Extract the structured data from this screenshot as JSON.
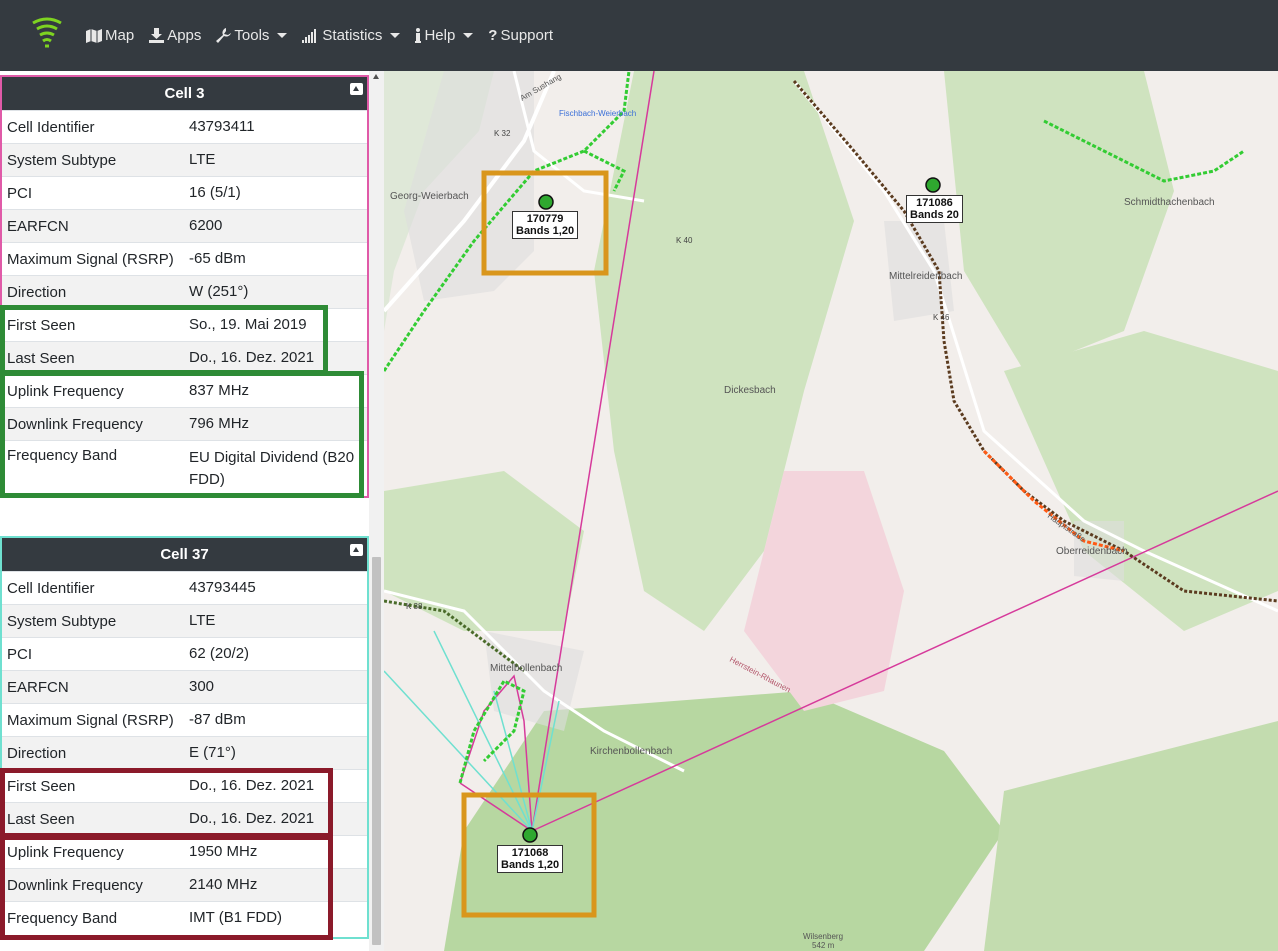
{
  "nav": {
    "items": [
      {
        "label": "Map",
        "icon": "map-icon",
        "dropdown": false
      },
      {
        "label": "Apps",
        "icon": "download-icon",
        "dropdown": false
      },
      {
        "label": "Tools",
        "icon": "wrench-icon",
        "dropdown": true
      },
      {
        "label": "Statistics",
        "icon": "signal-icon",
        "dropdown": true
      },
      {
        "label": "Help",
        "icon": "info-icon",
        "dropdown": true
      },
      {
        "label": "Support",
        "icon": "question-icon",
        "dropdown": false
      }
    ]
  },
  "cells": [
    {
      "title": "Cell 3",
      "rows": [
        {
          "label": "Cell Identifier",
          "value": "43793411"
        },
        {
          "label": "System Subtype",
          "value": "LTE"
        },
        {
          "label": "PCI",
          "value": "16 (5/1)"
        },
        {
          "label": "EARFCN",
          "value": "6200"
        },
        {
          "label": "Maximum Signal (RSRP)",
          "value": "-65 dBm"
        },
        {
          "label": "Direction",
          "value": "W (251°)"
        },
        {
          "label": "First Seen",
          "value": "So., 19. Mai 2019"
        },
        {
          "label": "Last Seen",
          "value": "Do., 16. Dez. 2021"
        },
        {
          "label": "Uplink Frequency",
          "value": "837 MHz"
        },
        {
          "label": "Downlink Frequency",
          "value": "796 MHz"
        },
        {
          "label": "Frequency Band",
          "value": "EU Digital Dividend (B20 FDD)"
        }
      ]
    },
    {
      "title": "Cell 37",
      "rows": [
        {
          "label": "Cell Identifier",
          "value": "43793445"
        },
        {
          "label": "System Subtype",
          "value": "LTE"
        },
        {
          "label": "PCI",
          "value": "62 (20/2)"
        },
        {
          "label": "EARFCN",
          "value": "300"
        },
        {
          "label": "Maximum Signal (RSRP)",
          "value": "-87 dBm"
        },
        {
          "label": "Direction",
          "value": "E (71°)"
        },
        {
          "label": "First Seen",
          "value": "Do., 16. Dez. 2021"
        },
        {
          "label": "Last Seen",
          "value": "Do., 16. Dez. 2021"
        },
        {
          "label": "Uplink Frequency",
          "value": "1950 MHz"
        },
        {
          "label": "Downlink Frequency",
          "value": "2140 MHz"
        },
        {
          "label": "Frequency Band",
          "value": "IMT (B1 FDD)"
        }
      ]
    }
  ],
  "map": {
    "markers": [
      {
        "id": "170779",
        "bands": "Bands 1,20"
      },
      {
        "id": "171086",
        "bands": "Bands 20"
      },
      {
        "id": "171068",
        "bands": "Bands 1,20"
      }
    ],
    "places": [
      "Georg-Weierbach",
      "Fischbach-Weierbach",
      "Mittelreidenbach",
      "Schmidthachenbach",
      "Dickesbach",
      "Oberreidenbach",
      "Mittelbollenbach",
      "Kirchenbollenbach",
      "Herrstein-Rhaunen",
      "Wilsenberg",
      "542 m",
      "Am Sushang",
      "K 32",
      "K 40",
      "K 46",
      "K 38",
      "Hauptstraße"
    ]
  },
  "colors": {
    "navbar": "#343a40",
    "cell3_border": "#e05aa8",
    "cell37_border": "#6fe0d0",
    "highlight_green": "#2e8b36",
    "highlight_red": "#8b1a2a",
    "highlight_orange": "#d9961c",
    "marker": "#2fa82f"
  }
}
